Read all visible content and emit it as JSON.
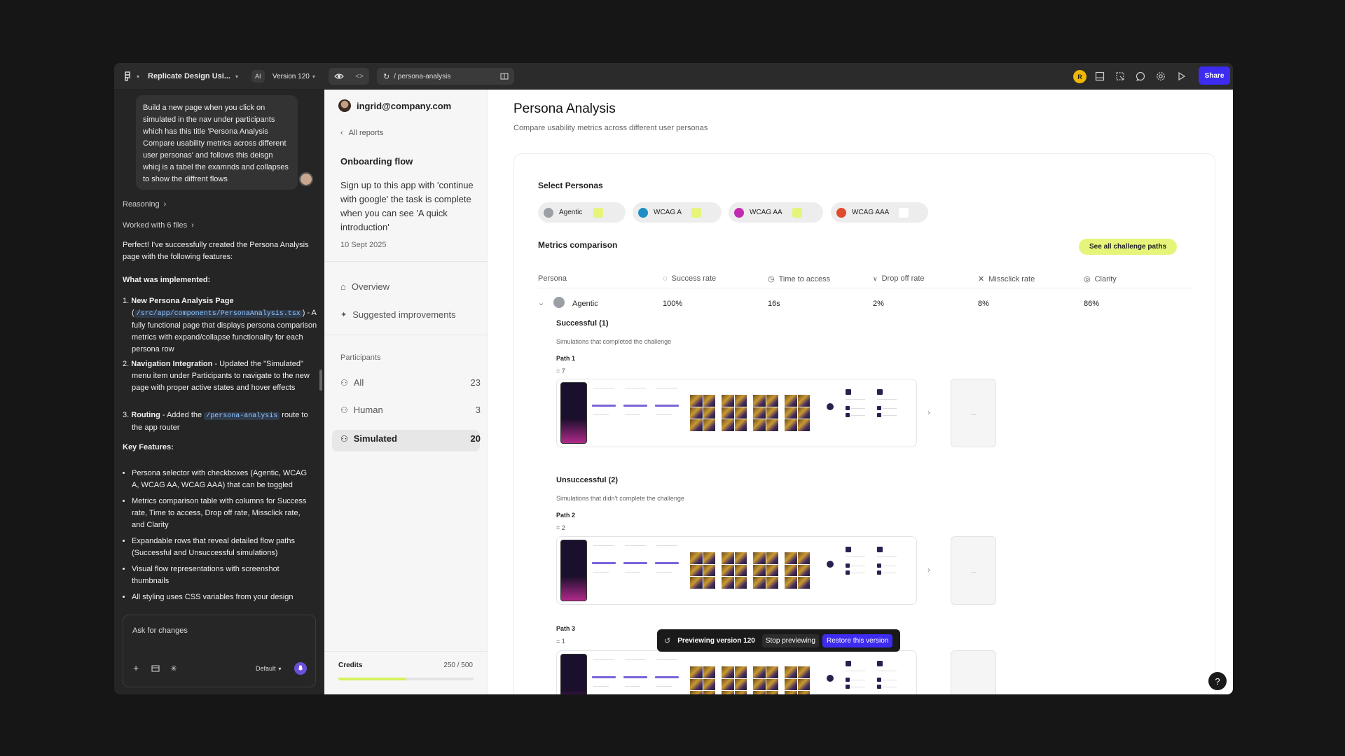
{
  "topbar": {
    "project_name": "Replicate Design Usi...",
    "ai_badge": "AI",
    "version": "Version 120",
    "url": "/ persona-analysis",
    "avatar_initial": "R",
    "share_label": "Share"
  },
  "chat": {
    "user_message": "Build a new page when you click on simulated in the nav under participants which has this title 'Persona Analysis Compare usability metrics across different user personas' and follows this deisgn whicj is a tabel the examnds and collapses to show the diffrent flows",
    "reasoning": "Reasoning",
    "worked_with": "Worked with 6 files",
    "intro": "Perfect! I've successfully created the Persona Analysis page with the following features:",
    "implemented_heading": "What was implemented:",
    "items": [
      {
        "num": "1.",
        "title": "New Persona Analysis Page",
        "code": "/src/app/components/PersonaAnalysis.tsx",
        "pre": "(",
        "post": ") - A fully functional page that displays persona comparison metrics with expand/collapse functionality for each persona row"
      },
      {
        "num": "2.",
        "title": "Navigation Integration",
        "text": " - Updated the \"Simulated\" menu item under Participants to navigate to the new page with proper active states and hover effects"
      },
      {
        "num": "3.",
        "title": "Routing",
        "text_pre": " - Added the ",
        "code": "/persona-analysis",
        "text_post": " route to the app router"
      }
    ],
    "features_heading": "Key Features:",
    "features": [
      "Persona selector with checkboxes (Agentic, WCAG A, WCAG AA, WCAG AAA) that can be toggled",
      "Metrics comparison table with columns for Success rate, Time to access, Drop off rate, Missclick rate, and Clarity",
      "Expandable rows that reveal detailed flow paths (Successful and Unsuccessful simulations)",
      "Visual flow representations with screenshot thumbnails",
      "All styling uses CSS variables from your design"
    ],
    "composer_placeholder": "Ask for changes",
    "model": "Default"
  },
  "nav": {
    "user_email": "ingrid@company.com",
    "back_label": "All reports",
    "flow_title": "Onboarding flow",
    "flow_desc": "Sign up to this app with 'continue with google' the task is complete when you can see 'A quick introduction'",
    "flow_date": "10 Sept 2025",
    "overview": "Overview",
    "suggested": "Suggested improvements",
    "participants_heading": "Participants",
    "participants": [
      {
        "label": "All",
        "count": "23"
      },
      {
        "label": "Human",
        "count": "3"
      },
      {
        "label": "Simulated",
        "count": "20"
      }
    ],
    "credits_label": "Credits",
    "credits_value": "250 / 500",
    "credits_used_fraction": 0.5
  },
  "main": {
    "title": "Persona Analysis",
    "subtitle": "Compare usability metrics across different user personas",
    "select_heading": "Select Personas",
    "personas": [
      {
        "label": "Agentic",
        "color": "#9aa0a6",
        "check": "#e6f57a"
      },
      {
        "label": "WCAG A",
        "color": "#1e8fc4",
        "check": "#e6f57a"
      },
      {
        "label": "WCAG AA",
        "color": "#c42bb0",
        "check": "#e6f57a"
      },
      {
        "label": "WCAG AAA",
        "color": "#e04a2f",
        "check": "#ffffff"
      }
    ],
    "metrics_heading": "Metrics comparison",
    "see_all": "See all challenge paths",
    "columns": [
      "Persona",
      "Success rate",
      "Time to access",
      "Drop off rate",
      "Missclick rate",
      "Clarity"
    ],
    "row": {
      "persona": "Agentic",
      "success": "100%",
      "time": "16s",
      "dropoff": "2%",
      "missclick": "8%",
      "clarity": "86%"
    },
    "successful_title": "Successful (1)",
    "successful_sub": "Simulations that completed the challenge",
    "unsuccessful_title": "Unsuccessful (2)",
    "unsuccessful_sub": "Simulations that didn't complete the challenge",
    "paths": [
      {
        "label": "Path 1",
        "count": "= 7"
      },
      {
        "label": "Path 2",
        "count": "= 2"
      },
      {
        "label": "Path 3",
        "count": "= 1"
      }
    ],
    "placeholder": "..."
  },
  "preview": {
    "text": "Previewing version 120",
    "stop": "Stop previewing",
    "restore": "Restore this version"
  },
  "help": "?"
}
